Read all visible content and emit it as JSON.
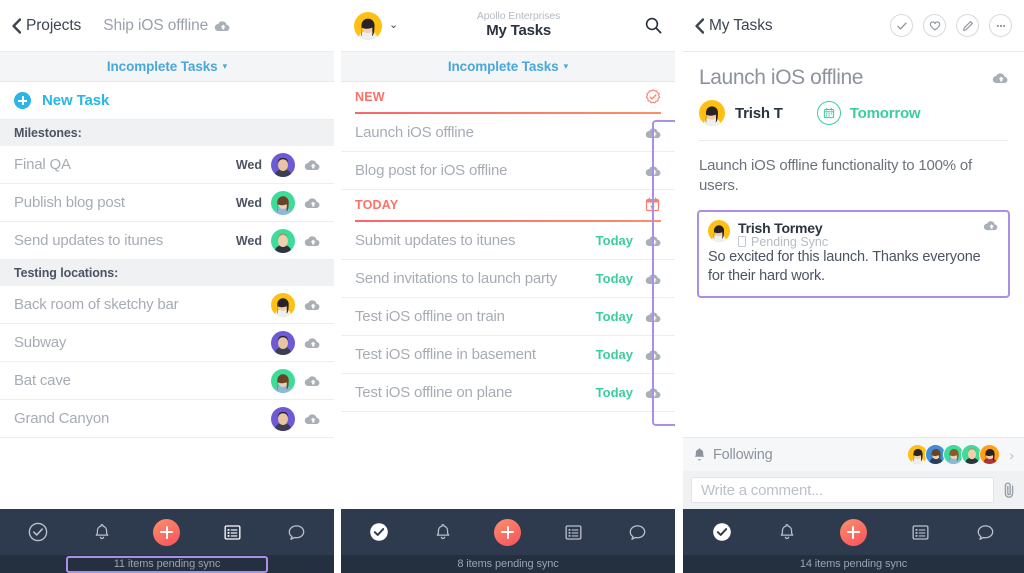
{
  "panel1": {
    "nav": {
      "back_label": "Projects",
      "title": "Ship iOS offline",
      "back_icon": "chevron-left-icon",
      "cloud_icon": "cloud-pending-icon"
    },
    "filter": {
      "label": "Incomplete Tasks",
      "caret": "▾"
    },
    "new_task": {
      "label": "New Task",
      "icon": "plus-circle-icon"
    },
    "sections": [
      {
        "header": "Milestones:",
        "rows": [
          {
            "label": "Final QA",
            "day": "Wed",
            "avatar_color": "#6f5ad6",
            "hair": "#2a2326",
            "skin": "#e8c4a0",
            "shirt": "#3c3f52"
          },
          {
            "label": "Publish blog post",
            "day": "Wed",
            "avatar_color": "#3ddc9a",
            "hair": "#6b4226",
            "skin": "#f0cfae",
            "shirt": "#8fb7d6"
          },
          {
            "label": "Send updates to itunes",
            "day": "Wed",
            "avatar_color": "#3ddc9a",
            "hair": "#b08a5e",
            "skin": "#f0cfae",
            "shirt": "#2e3340"
          }
        ]
      },
      {
        "header": "Testing locations:",
        "rows": [
          {
            "label": "Back room of sketchy bar",
            "day": "",
            "avatar_color": "#ffc014",
            "hair": "#2a2326",
            "skin": "#f0cfae",
            "shirt": "#efefef"
          },
          {
            "label": "Subway",
            "day": "",
            "avatar_color": "#6f5ad6",
            "hair": "#2a2326",
            "skin": "#e8c4a0",
            "shirt": "#3c3f52"
          },
          {
            "label": "Bat cave",
            "day": "",
            "avatar_color": "#3ddc9a",
            "hair": "#6b4226",
            "skin": "#f0cfae",
            "shirt": "#8fb7d6"
          },
          {
            "label": "Grand Canyon",
            "day": "",
            "avatar_color": "#6f5ad6",
            "hair": "#2a2326",
            "skin": "#e8c4a0",
            "shirt": "#3c3f52"
          }
        ]
      }
    ],
    "tabbar": {
      "items": [
        "check-circle-outline-icon",
        "bell-icon",
        "add-fab-icon",
        "list-icon",
        "chat-bubble-icon"
      ]
    },
    "status": "11 items pending sync",
    "status_highlighted": true
  },
  "panel2": {
    "nav": {
      "org": "Apollo Enterprises",
      "title": "My Tasks",
      "avatar_caret": "⌄",
      "search_icon": "search-icon"
    },
    "filter": {
      "label": "Incomplete Tasks",
      "caret": "▾"
    },
    "sections": [
      {
        "header": "NEW",
        "icon": "new-badge-icon",
        "rows": [
          {
            "label": "Launch iOS offline",
            "due": ""
          },
          {
            "label": "Blog post for iOS offline",
            "due": ""
          }
        ]
      },
      {
        "header": "TODAY",
        "icon": "calendar-today-icon",
        "rows": [
          {
            "label": "Submit updates to itunes",
            "due": "Today"
          },
          {
            "label": "Send invitations to launch party",
            "due": "Today"
          },
          {
            "label": "Test iOS offline on train",
            "due": "Today"
          },
          {
            "label": "Test iOS offline in basement",
            "due": "Today"
          },
          {
            "label": "Test iOS offline on plane",
            "due": "Today"
          }
        ]
      }
    ],
    "tabbar": {
      "items": [
        "check-circle-filled-icon",
        "bell-icon",
        "add-fab-icon",
        "list-icon",
        "chat-bubble-icon"
      ]
    },
    "status": "8 items pending sync",
    "status_highlighted": false
  },
  "panel3": {
    "nav": {
      "back_label": "My Tasks",
      "actions": [
        "complete-check-icon",
        "heart-icon",
        "edit-pencil-icon",
        "more-ellipsis-icon"
      ]
    },
    "task": {
      "title": "Launch iOS offline",
      "assignee": "Trish T",
      "due": "Tomorrow",
      "description": "Launch iOS offline functionality to 100% of users."
    },
    "comment": {
      "author": "Trish Tormey",
      "status": "Pending Sync",
      "body": "So excited for this launch. Thanks everyone for their hard work."
    },
    "following": {
      "label": "Following",
      "bell_icon": "bell-icon",
      "chevron": "›",
      "avatars": [
        "#ffc014",
        "#3f8fd8",
        "#3ddc9a",
        "#3ddc9a",
        "#ffa014"
      ]
    },
    "comment_box": {
      "placeholder": "Write a comment...",
      "attach_icon": "paperclip-icon"
    },
    "tabbar": {
      "items": [
        "check-circle-filled-icon",
        "bell-icon",
        "add-fab-icon",
        "list-icon",
        "chat-bubble-icon"
      ]
    },
    "status": "14 items pending sync",
    "status_highlighted": false
  },
  "colors": {
    "accent_blue": "#29b6e8",
    "accent_coral": "#fa7268",
    "accent_green": "#3bce9a",
    "highlight_purple": "#a98fe8",
    "tabbar_bg": "#2e3a4e",
    "status_bg": "#242f40"
  }
}
